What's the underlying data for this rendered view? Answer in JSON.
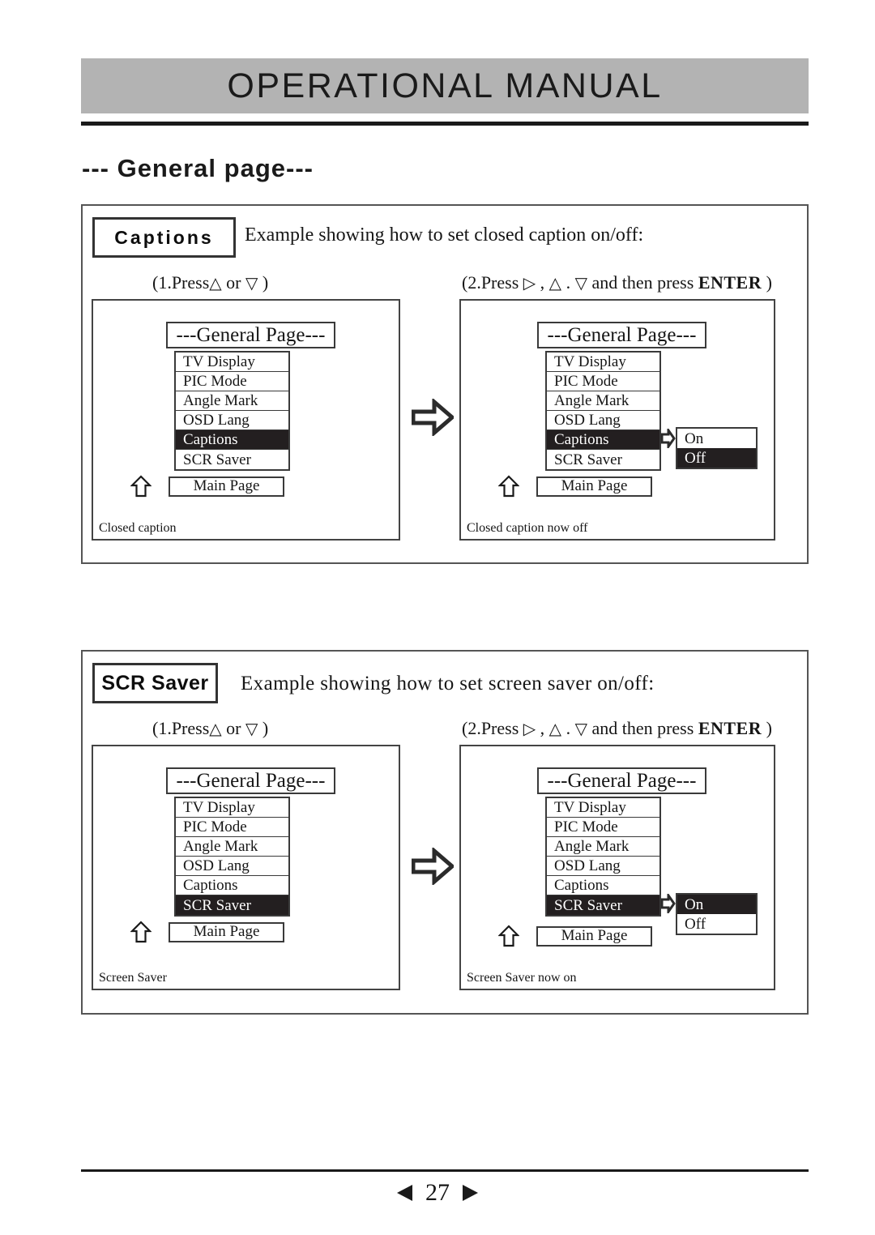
{
  "header": {
    "title": "OPERATIONAL MANUAL"
  },
  "page_heading": "--- General  page---",
  "sections": [
    {
      "tag": "Captions",
      "intro": "Example showing how to set closed caption on/off:",
      "step1": {
        "prefix": "(1.Press",
        "tri_up": "△",
        "mid": " or ",
        "tri_down": "▽",
        "suffix": " )"
      },
      "step2": {
        "prefix": "(2.Press ",
        "tri_right": "▷",
        "sep1": " , ",
        "tri_up": "△",
        "sep2": " . ",
        "tri_down": "▽",
        "mid": " and then press ",
        "enter": "ENTER",
        "suffix": " )"
      },
      "panel_left": {
        "title": "---General Page---",
        "menu": [
          {
            "label": "TV Display",
            "selected": false
          },
          {
            "label": "PIC Mode",
            "selected": false
          },
          {
            "label": "Angle Mark",
            "selected": false
          },
          {
            "label": "OSD Lang",
            "selected": true
          },
          {
            "label": "Captions",
            "selected": false
          },
          {
            "label": "SCR Saver",
            "selected": false
          }
        ],
        "main_page": "Main Page",
        "status": "Closed caption"
      },
      "panel_right": {
        "title": "---General Page---",
        "menu": [
          {
            "label": "TV Display",
            "selected": false
          },
          {
            "label": "PIC Mode",
            "selected": false
          },
          {
            "label": "Angle Mark",
            "selected": false
          },
          {
            "label": "OSD Lang",
            "selected": false
          },
          {
            "label": "Captions",
            "selected": true
          },
          {
            "label": "SCR Saver",
            "selected": false
          }
        ],
        "submenu": [
          {
            "label": "On",
            "selected": false
          },
          {
            "label": "Off",
            "selected": true
          }
        ],
        "main_page": "Main Page",
        "status": "Closed caption now off"
      }
    },
    {
      "tag": "SCR Saver",
      "intro": "Example showing how to set screen saver on/off:",
      "step1": {
        "prefix": "(1.Press",
        "tri_up": "△",
        "mid": " or ",
        "tri_down": "▽",
        "suffix": " )"
      },
      "step2": {
        "prefix": "(2.Press ",
        "tri_right": "▷",
        "sep1": " , ",
        "tri_up": "△",
        "sep2": " . ",
        "tri_down": "▽",
        "mid": " and then press ",
        "enter": "ENTER",
        "suffix": " )"
      },
      "panel_left": {
        "title": "---General Page---",
        "menu": [
          {
            "label": "TV Display",
            "selected": false
          },
          {
            "label": "PIC Mode",
            "selected": false
          },
          {
            "label": "Angle Mark",
            "selected": false
          },
          {
            "label": "OSD Lang",
            "selected": false
          },
          {
            "label": "Captions",
            "selected": false
          },
          {
            "label": "SCR Saver",
            "selected": true
          }
        ],
        "main_page": "Main Page",
        "status": "Screen Saver"
      },
      "panel_right": {
        "title": "---General Page---",
        "menu": [
          {
            "label": "TV Display",
            "selected": false
          },
          {
            "label": "PIC Mode",
            "selected": false
          },
          {
            "label": "Angle Mark",
            "selected": false
          },
          {
            "label": "OSD Lang",
            "selected": false
          },
          {
            "label": "Captions",
            "selected": false
          },
          {
            "label": "SCR Saver",
            "selected": true
          }
        ],
        "submenu": [
          {
            "label": "On",
            "selected": true
          },
          {
            "label": "Off",
            "selected": false
          }
        ],
        "main_page": "Main Page",
        "status": "Screen Saver now on"
      }
    }
  ],
  "footer": {
    "page_number": "27",
    "prev_icon": "triangle-left-icon",
    "next_icon": "triangle-right-icon"
  },
  "colors": {
    "header_bar": "#b3b3b3",
    "selected_bg": "#231f20",
    "ink": "#1a1a1a"
  }
}
